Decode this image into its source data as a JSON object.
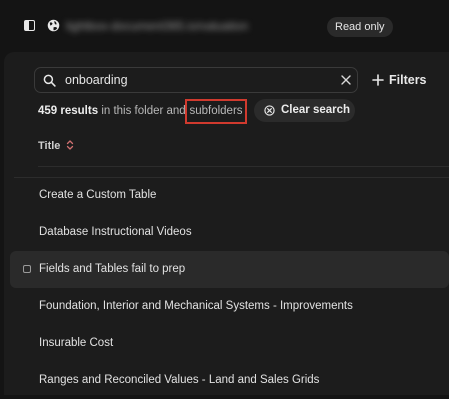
{
  "topbar": {
    "url": "lightbox-document365.io/valuation",
    "readonly_label": "Read only",
    "sidebar_toggle_icon": "sidebar-toggle-icon",
    "globe_icon": "globe-icon"
  },
  "search": {
    "value": "onboarding",
    "placeholder": "",
    "search_icon": "search-icon",
    "clear_icon": "close-icon"
  },
  "filters": {
    "label": "Filters",
    "icon": "plus-icon"
  },
  "results": {
    "count": "459 results",
    "text": "in this folder and",
    "subfolders_label": "subfolders",
    "clear_search_label": "Clear search",
    "clear_search_icon": "circle-x-icon",
    "highlight_color": "#d03a2e"
  },
  "table": {
    "title_header": "Title",
    "sort_icon": "sort-updown-icon",
    "sort_icon_color": "#d07070",
    "rows": [
      "Create a Custom Table",
      "Database Instructional Videos",
      "Fields and Tables fail to prep",
      "Foundation, Interior and Mechanical Systems - Improvements",
      "Insurable Cost",
      "Ranges and Reconciled Values - Land and Sales Grids"
    ]
  }
}
